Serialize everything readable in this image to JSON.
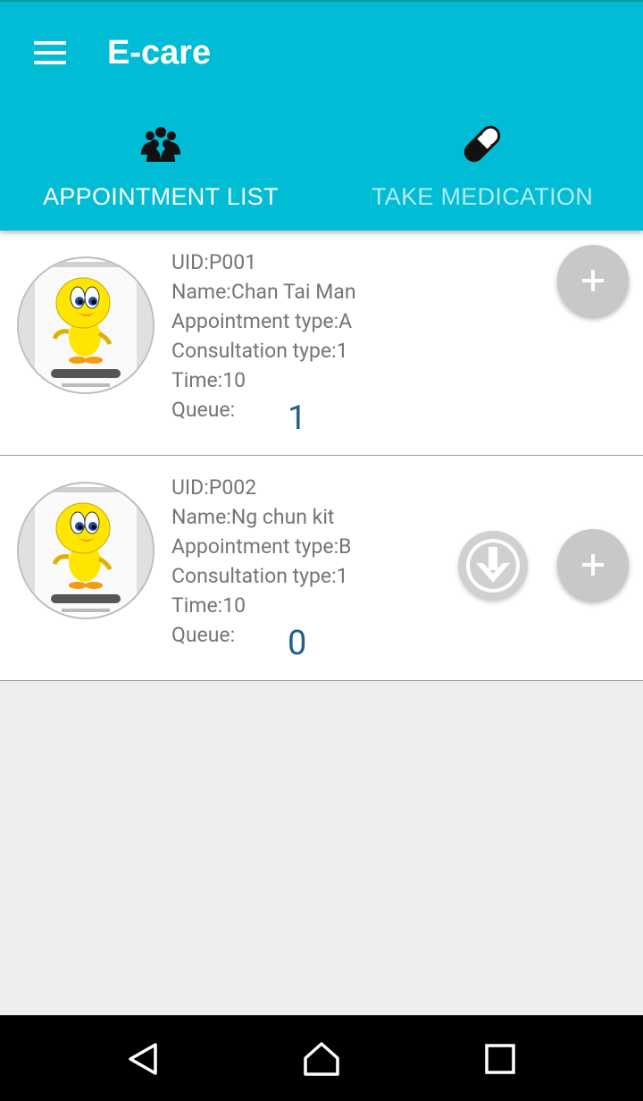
{
  "app": {
    "title": "E-care"
  },
  "tabs": [
    {
      "label": "APPOINTMENT LIST",
      "icon": "group-icon",
      "active": true
    },
    {
      "label": "TAKE MEDICATION",
      "icon": "pill-icon",
      "active": false
    }
  ],
  "appointments": [
    {
      "uid": "UID:P001",
      "name": "Name:Chan Tai Man",
      "appointment_type": "Appointment type:A",
      "consultation_type": "Consultation type:1",
      "time": "Time:10",
      "queue_label": "Queue:",
      "queue": "1"
    },
    {
      "uid": "UID:P002",
      "name": "Name:Ng chun kit",
      "appointment_type": "Appointment type:B",
      "consultation_type": "Consultation type:1",
      "time": "Time:10",
      "queue_label": "Queue:",
      "queue": "0"
    }
  ],
  "colors": {
    "primary": "#00bcd4",
    "queue_number": "#1f5f8b",
    "fab": "#c8c8c8",
    "text": "#757575"
  }
}
